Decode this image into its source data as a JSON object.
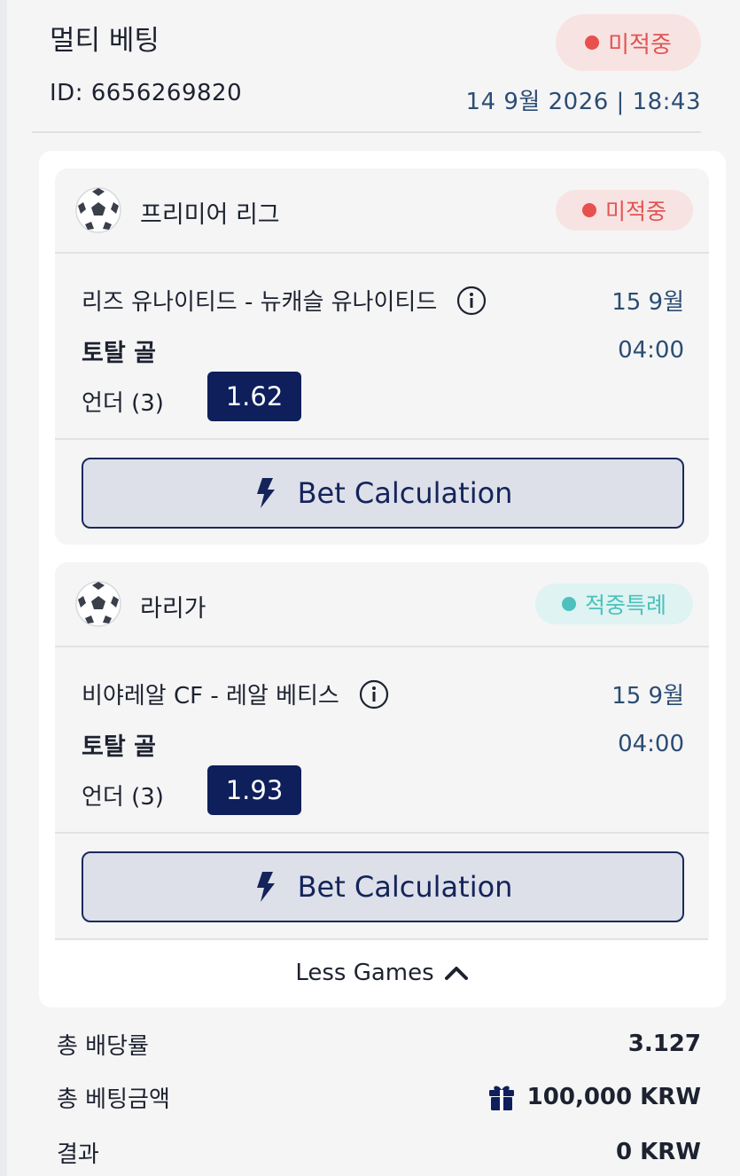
{
  "header": {
    "title": "멀티 베팅",
    "bet_id": "ID: 6656269820",
    "status": "미적중",
    "datetime": "14 9월 2026 | 18:43"
  },
  "games": [
    {
      "league": "프리미어 리그",
      "status": "미적중",
      "match": "리즈 유나이티드 - 뉴캐슬 유나이티드",
      "date": "15 9월",
      "time": "04:00",
      "market": "토탈 골",
      "selection": "언더 (3)",
      "odds": "1.62",
      "calc_label": "Bet Calculation"
    },
    {
      "league": "라리가",
      "status": "적중특례",
      "match": "비야레알 CF - 레알 베티스",
      "date": "15 9월",
      "time": "04:00",
      "market": "토탈 골",
      "selection": "언더 (3)",
      "odds": "1.93",
      "calc_label": "Bet Calculation"
    }
  ],
  "less_games_label": "Less Games",
  "summary": {
    "total_odds_label": "총 배당률",
    "total_odds_value": "3.127",
    "total_stake_label": "총 베팅금액",
    "total_stake_value": "100,000 KRW",
    "result_label": "결과",
    "result_value": "0 KRW"
  },
  "colors": {
    "lost": "#e8504d",
    "special": "#4cc1bd",
    "odds_bg": "#0e1f5c",
    "accent_text": "#2c4d73"
  }
}
